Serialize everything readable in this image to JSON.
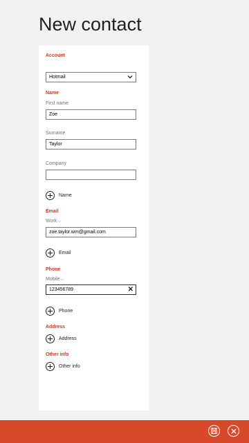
{
  "page": {
    "title": "New contact"
  },
  "account": {
    "header": "Account",
    "selected": "Hotmail"
  },
  "name": {
    "header": "Name",
    "first_name_label": "First name",
    "first_name_value": "Zoe",
    "surname_label": "Surname",
    "surname_value": "Taylor",
    "company_label": "Company",
    "company_value": "",
    "add_label": "Name"
  },
  "email": {
    "header": "Email",
    "type_label": "Work",
    "value": "zoe.taylor.wm@gmail.com",
    "add_label": "Email"
  },
  "phone": {
    "header": "Phone",
    "type_label": "Mobile",
    "value": "123456789",
    "add_label": "Phone"
  },
  "address": {
    "header": "Address",
    "add_label": "Address"
  },
  "other_info": {
    "header": "Other info",
    "add_label": "Other info"
  },
  "app_bar": {
    "color": "#d8492a",
    "save_icon": "save-icon",
    "cancel_icon": "cancel-icon"
  },
  "colors": {
    "accent": "#c8391e",
    "background": "#f2f2f2",
    "panel": "#ffffff"
  }
}
